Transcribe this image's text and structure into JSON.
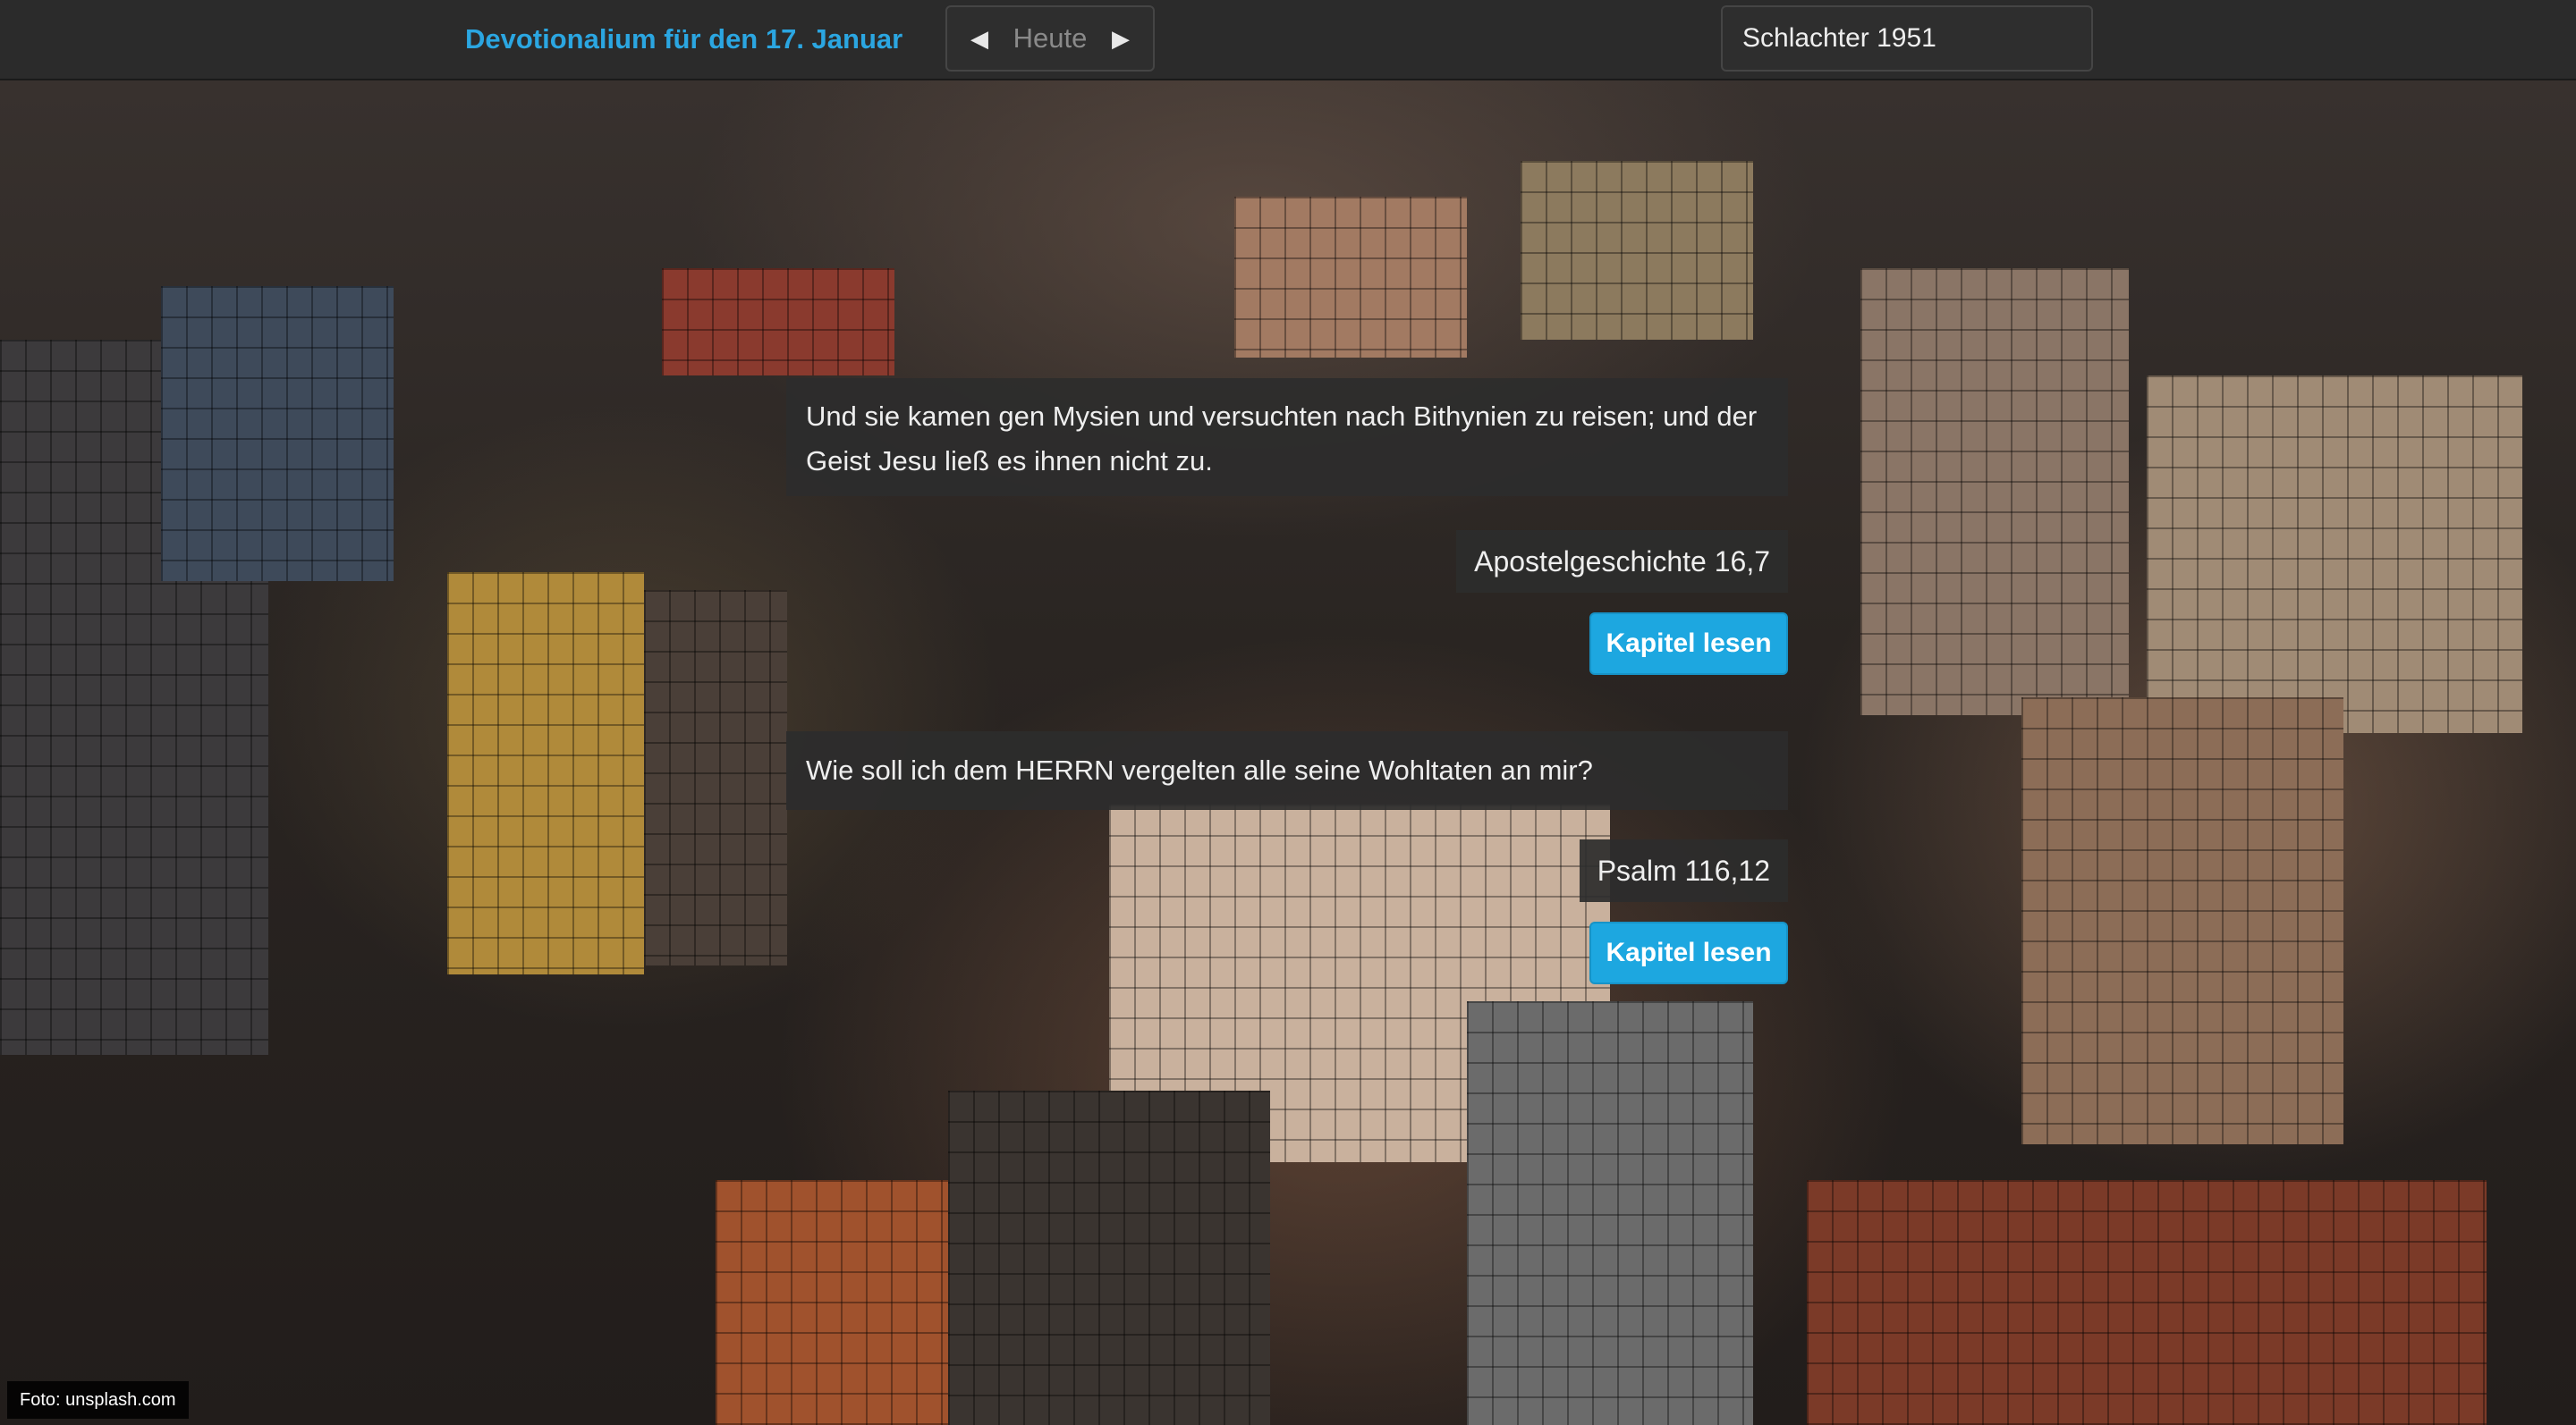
{
  "navbar": {
    "title": "Devotionalium für den 17. Januar",
    "prev_icon": "triangle-left-icon",
    "today_label": "Heute",
    "next_icon": "triangle-right-icon",
    "translation": "Schlachter 1951"
  },
  "verses": [
    {
      "text": "Und sie kamen gen Mysien und versuchten nach Bithynien zu reisen; und der Geist Jesu ließ es ihnen nicht zu.",
      "reference": "Apostelgeschichte 16,7",
      "button_label": "Kapitel lesen"
    },
    {
      "text": "Wie soll ich dem HERRN vergelten alle seine Wohltaten an mir?",
      "reference": "Psalm 116,12",
      "button_label": "Kapitel lesen"
    }
  ],
  "photo_credit": "Foto: unsplash.com",
  "colors": {
    "accent": "#2ba6e1",
    "button": "#1da7e0",
    "navbar": "#2b2b2b"
  }
}
